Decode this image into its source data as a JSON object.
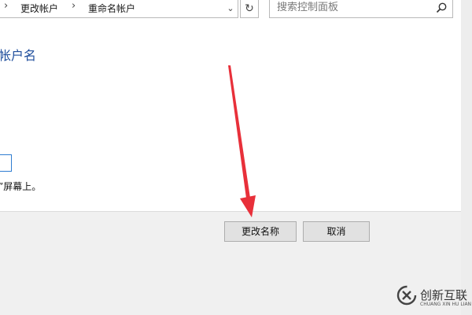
{
  "breadcrumb": {
    "items": [
      "更改帐户",
      "重命名帐户"
    ],
    "separator": "›"
  },
  "search": {
    "placeholder": "搜索控制面板"
  },
  "main": {
    "heading": "帐户名",
    "note": "”屏幕上。"
  },
  "buttons": {
    "change_name": "更改名称",
    "cancel": "取消"
  },
  "watermark": {
    "text": "创新互联",
    "subtext": "CHUANG XIN HU LIAN"
  },
  "colors": {
    "heading": "#1f4e9c",
    "arrow": "#e8303a",
    "panel": "#f0f0f0",
    "focus_border": "#2f7dd1"
  }
}
